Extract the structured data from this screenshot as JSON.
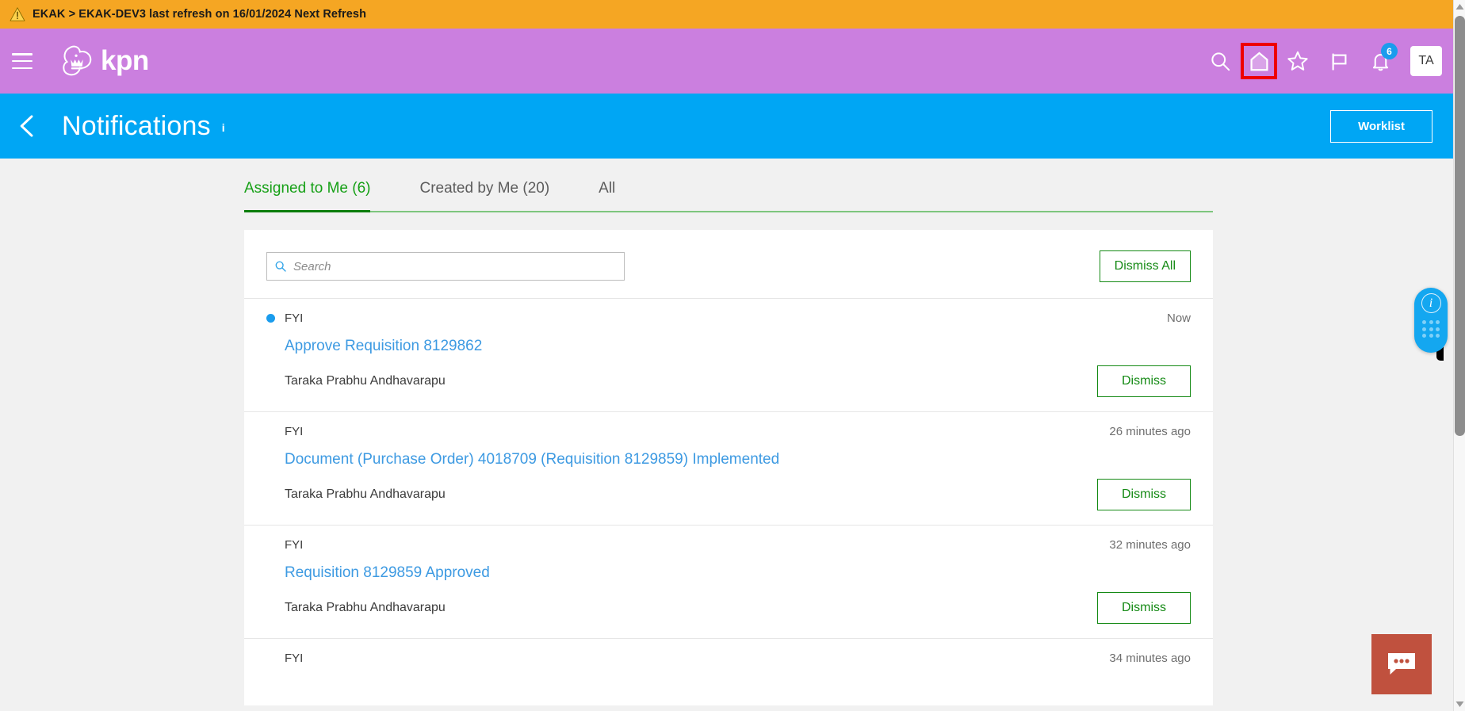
{
  "alert_banner": {
    "icon": "warning-triangle-icon",
    "text": "EKAK > EKAK-DEV3 last refresh on 16/01/2024 Next Refresh",
    "background": "#f5a623"
  },
  "appbar": {
    "background": "#cb7fdf",
    "menu_icon": "hamburger-menu-icon",
    "brand_name": "kpn",
    "brand_logo_icon": "kpn-crown-logo-icon",
    "icons": [
      {
        "name": "search-icon",
        "label": "Search"
      },
      {
        "name": "home-icon",
        "label": "Home",
        "highlighted": true,
        "highlight_color": "#ee0000"
      },
      {
        "name": "star-icon",
        "label": "Favorites"
      },
      {
        "name": "flag-icon",
        "label": "Flagged"
      },
      {
        "name": "bell-icon",
        "label": "Notifications",
        "badge": "6",
        "badge_color": "#1a9ced"
      }
    ],
    "avatar_initials": "TA"
  },
  "page_header": {
    "background": "#00a6f4",
    "back_icon": "back-chevron-icon",
    "title": "Notifications",
    "info_marker": "i",
    "worklist_label": "Worklist"
  },
  "tabs": [
    {
      "label": "Assigned to Me (6)",
      "active": true
    },
    {
      "label": "Created by Me (20)",
      "active": false
    },
    {
      "label": "All",
      "active": false
    }
  ],
  "toolbar": {
    "search_placeholder": "Search",
    "search_value": "",
    "search_icon": "search-icon",
    "dismiss_all_label": "Dismiss All"
  },
  "notifications": [
    {
      "type": "FYI",
      "unread": true,
      "time": "Now",
      "link": "Approve Requisition 8129862",
      "user": "Taraka Prabhu Andhavarapu",
      "dismiss_label": "Dismiss"
    },
    {
      "type": "FYI",
      "unread": false,
      "time": "26 minutes ago",
      "link": "Document (Purchase Order) 4018709 (Requisition 8129859) Implemented",
      "user": "Taraka Prabhu Andhavarapu",
      "dismiss_label": "Dismiss"
    },
    {
      "type": "FYI",
      "unread": false,
      "time": "32 minutes ago",
      "link": "Requisition 8129859 Approved",
      "user": "Taraka Prabhu Andhavarapu",
      "dismiss_label": "Dismiss"
    }
  ],
  "partial_notification": {
    "type": "FYI",
    "time": "34 minutes ago"
  },
  "widgets": {
    "help_icon": "info-circle-icon",
    "help_grid_icon": "dot-grid-icon",
    "help_color": "#14a7f0",
    "chat_icon": "chat-bubble-icon",
    "chat_color": "#c0513e",
    "edge_tab_icon": "panel-handle-icon"
  },
  "scrollbar": {
    "up_icon": "scroll-up-arrow-icon",
    "down_icon": "scroll-down-arrow-icon",
    "thumb_icon": "scroll-thumb"
  }
}
